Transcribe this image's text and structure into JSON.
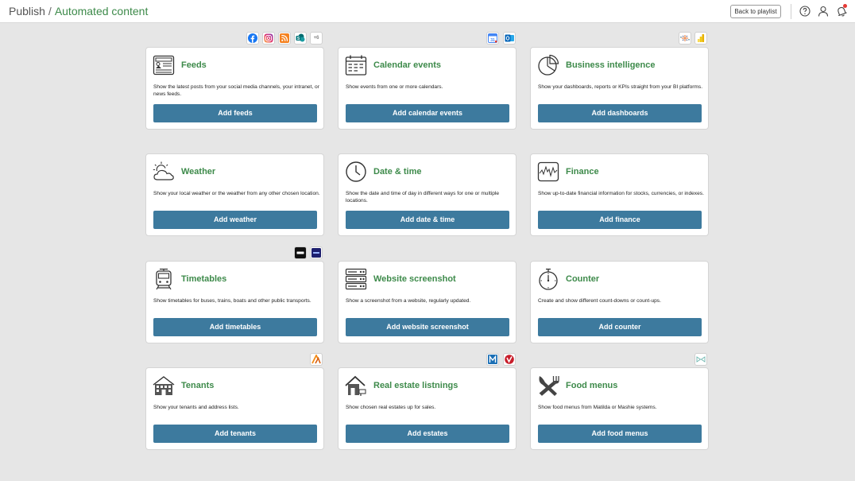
{
  "header": {
    "breadcrumb_root": "Publish",
    "breadcrumb_separator": "/",
    "breadcrumb_current": "Automated content",
    "back_button": "Back to playlist",
    "icons": [
      "help-icon",
      "user-icon",
      "notifications-icon"
    ]
  },
  "cards": [
    {
      "title": "Feeds",
      "description": "Show the latest posts from your social media channels, your intranet, or news feeds.",
      "button": "Add feeds",
      "icon": "feeds-icon",
      "badges": [
        "facebook",
        "instagram",
        "rss",
        "sharepoint"
      ],
      "badge_more": "+6"
    },
    {
      "title": "Calendar events",
      "description": "Show events from one or more calendars.",
      "button": "Add calendar events",
      "icon": "calendar-icon",
      "badges": [
        "google-calendar",
        "outlook"
      ]
    },
    {
      "title": "Business intelligence",
      "description": "Show your dashboards, reports or KPIs straight from your BI platforms.",
      "button": "Add dashboards",
      "icon": "pie-chart-icon",
      "badges": [
        "tableau",
        "power-bi"
      ]
    },
    {
      "title": "Weather",
      "description": "Show your local weather or the weather from any other chosen location.",
      "button": "Add weather",
      "icon": "weather-icon",
      "badges": []
    },
    {
      "title": "Date & time",
      "description": "Show the date and time of day in different ways for one or multiple locations.",
      "button": "Add date & time",
      "icon": "clock-icon",
      "badges": []
    },
    {
      "title": "Finance",
      "description": "Show up-to-date financial information for stocks, currencies, or indexes.",
      "button": "Add finance",
      "icon": "finance-chart-icon",
      "badges": []
    },
    {
      "title": "Timetables",
      "description": "Show timetables for buses, trains, boats and other public transports.",
      "button": "Add timetables",
      "icon": "train-icon",
      "badges": [
        "transit-provider-1",
        "transit-provider-2"
      ]
    },
    {
      "title": "Website screenshot",
      "description": "Show a screenshot from a website, regularly updated.",
      "button": "Add website screenshot",
      "icon": "server-icon",
      "badges": []
    },
    {
      "title": "Counter",
      "description": "Create and show different count-downs or count-ups.",
      "button": "Add counter",
      "icon": "stopwatch-icon",
      "badges": []
    },
    {
      "title": "Tenants",
      "description": "Show your tenants and address lists.",
      "button": "Add tenants",
      "icon": "building-icon",
      "badges": [
        "tenant-provider"
      ]
    },
    {
      "title": "Real estate listnings",
      "description": "Show chosen real estates up for sales.",
      "button": "Add estates",
      "icon": "house-icon",
      "badges": [
        "real-estate-provider-m",
        "real-estate-provider-v"
      ]
    },
    {
      "title": "Food menus",
      "description": "Show food menus from Matilda or Mashie systems.",
      "button": "Add food menus",
      "icon": "fork-knife-icon",
      "badges": [
        "food-menu-provider"
      ]
    }
  ],
  "colors": {
    "accent_green": "#3d8a4a",
    "button_blue": "#3d7a9e",
    "background": "#e6e6e6"
  }
}
